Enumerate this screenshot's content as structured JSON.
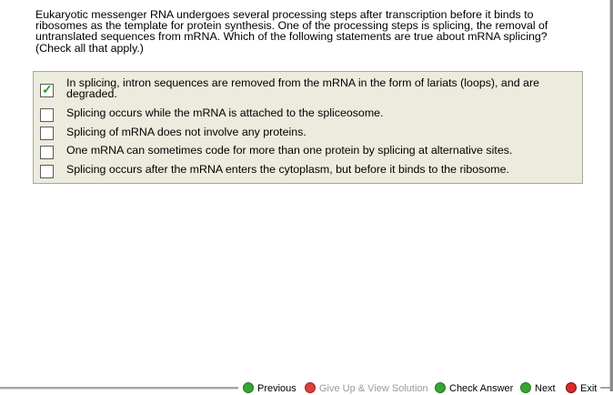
{
  "question": {
    "text": "Eukaryotic messenger RNA undergoes several processing steps after transcription before it binds to ribosomes as the template for protein synthesis. One of the processing steps is splicing, the removal of untranslated sequences from mRNA. Which of the following statements are true about mRNA splicing? (Check all that apply.)"
  },
  "choices": [
    {
      "label": "In splicing, intron sequences are removed from the mRNA in the form of lariats (loops), and are degraded.",
      "checked": true
    },
    {
      "label": "Splicing occurs while the mRNA is attached to the spliceosome.",
      "checked": false
    },
    {
      "label": "Splicing of mRNA does not involve any proteins.",
      "checked": false
    },
    {
      "label": "One mRNA can sometimes code for more than one protein by splicing at alternative sites.",
      "checked": false
    },
    {
      "label": "Splicing occurs after the mRNA enters the cytoplasm, but before it binds to the ribosome.",
      "checked": false
    }
  ],
  "check_glyph": "✓",
  "nav": {
    "previous": "Previous",
    "give_up": "Give Up & View Solution",
    "check_answer": "Check Answer",
    "next": "Next",
    "exit": "Exit"
  }
}
